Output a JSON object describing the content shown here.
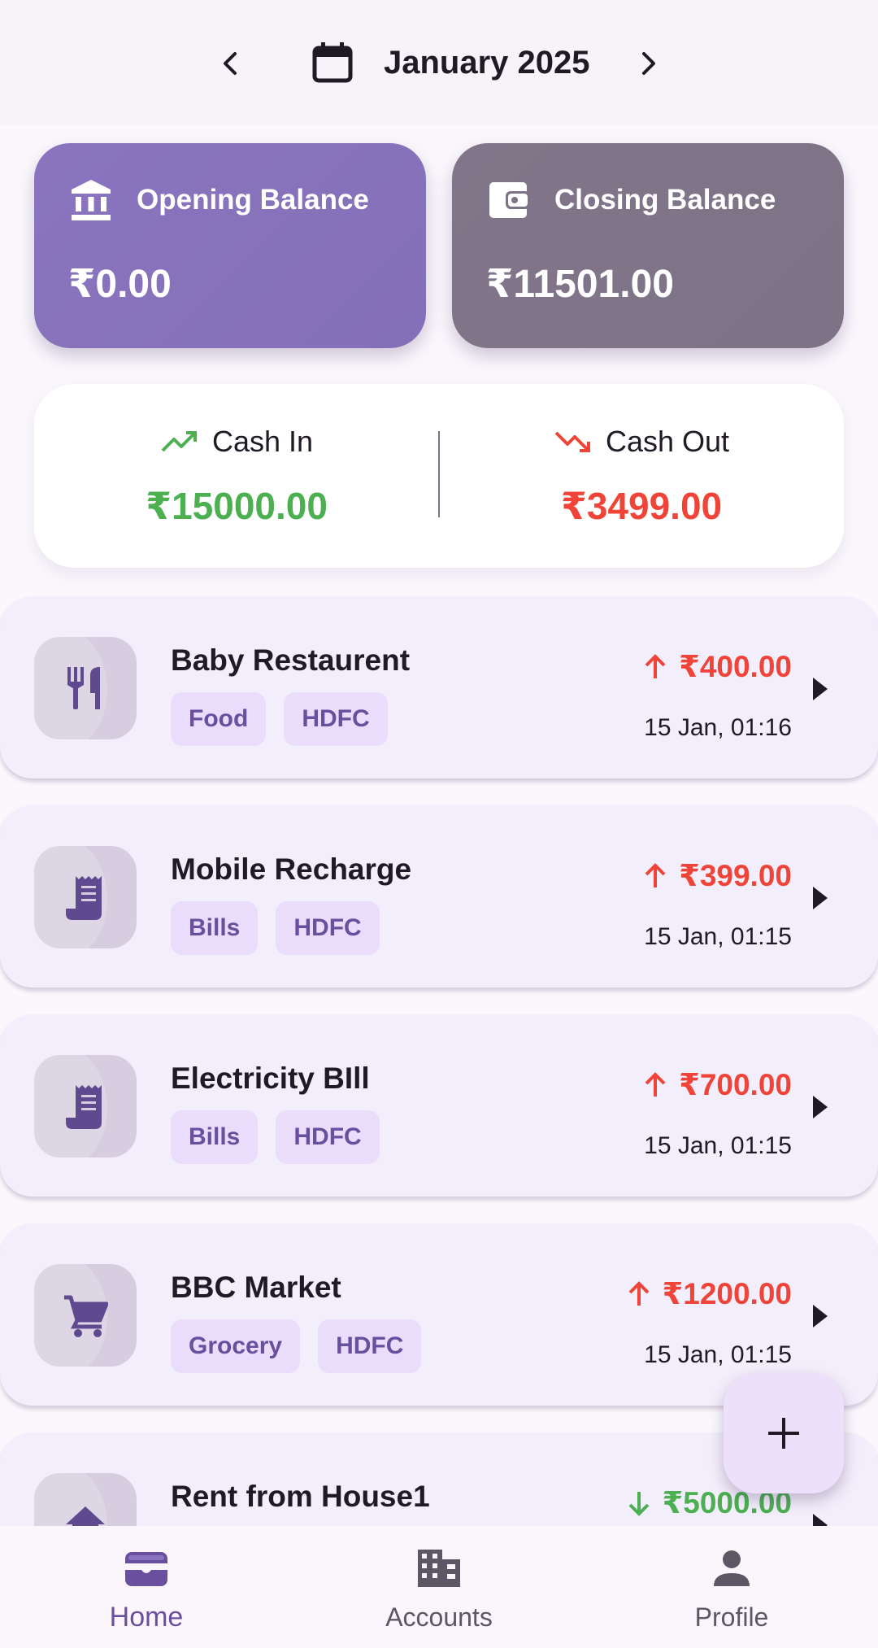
{
  "header": {
    "month_label": "January 2025"
  },
  "balances": {
    "opening_label": "Opening Balance",
    "opening_value": "₹0.00",
    "closing_label": "Closing Balance",
    "closing_value": "₹11501.00"
  },
  "cash": {
    "in_label": "Cash In",
    "in_value": "₹15000.00",
    "out_label": "Cash Out",
    "out_value": "₹3499.00"
  },
  "transactions": [
    {
      "title": "Baby Restaurent",
      "category": "Food",
      "account": "HDFC",
      "amount": "₹400.00",
      "direction": "out",
      "time": "15 Jan, 01:16",
      "icon": "restaurant-icon"
    },
    {
      "title": "Mobile Recharge",
      "category": "Bills",
      "account": "HDFC",
      "amount": "₹399.00",
      "direction": "out",
      "time": "15 Jan, 01:15",
      "icon": "receipt-icon"
    },
    {
      "title": "Electricity BIll",
      "category": "Bills",
      "account": "HDFC",
      "amount": "₹700.00",
      "direction": "out",
      "time": "15 Jan, 01:15",
      "icon": "receipt-icon"
    },
    {
      "title": "BBC Market",
      "category": "Grocery",
      "account": "HDFC",
      "amount": "₹1200.00",
      "direction": "out",
      "time": "15 Jan, 01:15",
      "icon": "cart-icon"
    },
    {
      "title": "Rent from House1",
      "category": "",
      "account": "",
      "amount": "₹5000.00",
      "direction": "in",
      "time": "",
      "icon": "house-icon"
    }
  ],
  "colors": {
    "accent": "#6a4f9e",
    "income": "#4caf50",
    "expense": "#f04438",
    "opening_card": "#8a74bf",
    "closing_card": "#817689"
  },
  "bottom_nav": {
    "items": [
      {
        "label": "Home",
        "icon": "wallet-icon",
        "active": true
      },
      {
        "label": "Accounts",
        "icon": "building-icon",
        "active": false
      },
      {
        "label": "Profile",
        "icon": "person-icon",
        "active": false
      }
    ]
  }
}
